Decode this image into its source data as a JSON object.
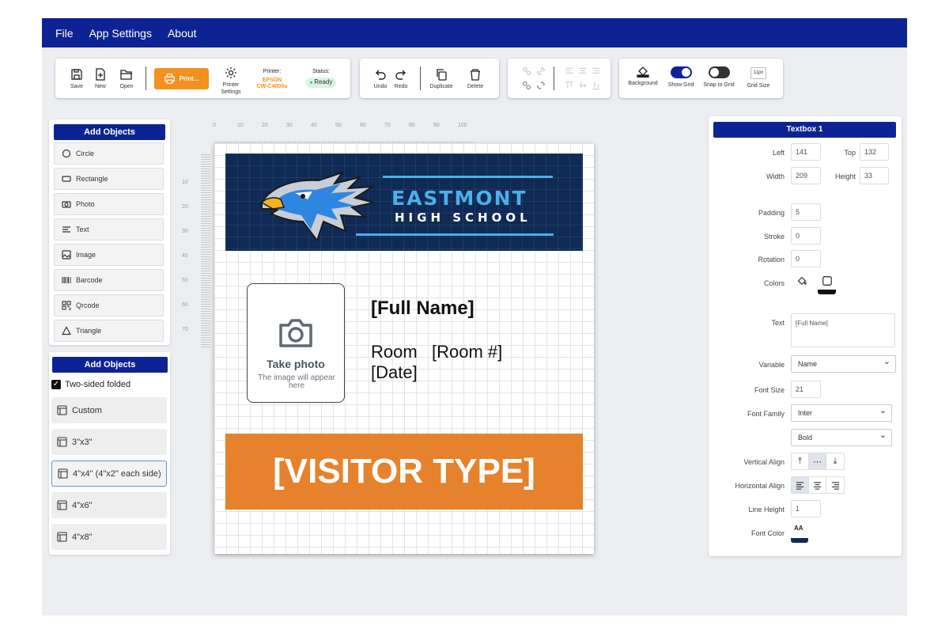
{
  "menu": [
    "File",
    "App Settings",
    "About"
  ],
  "toolbar": {
    "file": {
      "save": "Save",
      "new": "New",
      "open": "Open"
    },
    "print_label": "Print...",
    "printer_settings": "Printer\nSettings",
    "printer_label": "Printer:",
    "printer_name_1": "EPSON",
    "printer_name_2": "CW-C4000u",
    "status_label": "Status:",
    "status_value": "Ready",
    "edit": {
      "undo": "Undo",
      "redo": "Redo",
      "duplicate": "Duplicate",
      "delete": "Delete"
    },
    "view": {
      "background": "Background",
      "show_grid": "Show Grid",
      "snap_to_grid": "Snap to Grid",
      "grid_size": "Grid Size",
      "grid_size_value": "11px"
    },
    "show_grid_on": true,
    "snap_to_grid_on": false
  },
  "add_objects": {
    "title": "Add Objects",
    "items": [
      {
        "label": "Circle",
        "icon": "circle-icon"
      },
      {
        "label": "Rectangle",
        "icon": "rectangle-icon"
      },
      {
        "label": "Photo",
        "icon": "camera-icon"
      },
      {
        "label": "Text",
        "icon": "text-icon"
      },
      {
        "label": "Image",
        "icon": "image-icon"
      },
      {
        "label": "Barcode",
        "icon": "barcode-icon"
      },
      {
        "label": "Qrcode",
        "icon": "qrcode-icon"
      },
      {
        "label": "Triangle",
        "icon": "triangle-icon"
      }
    ]
  },
  "templates": {
    "title": "Add Objects",
    "two_sided_label": "Two-sided folded",
    "two_sided_checked": true,
    "items": [
      "Custom",
      "3\"x3\"",
      "4\"x4\" (4\"x2\" each side)",
      "4\"x6\"",
      "4\"x8\""
    ],
    "selected": "4\"x4\" (4\"x2\" each side)"
  },
  "rulers": {
    "horizontal": [
      "0",
      "10",
      "20",
      "30",
      "40",
      "50",
      "60",
      "70",
      "80",
      "90",
      "100"
    ],
    "vertical": [
      "10",
      "20",
      "30",
      "40",
      "50",
      "60",
      "70"
    ]
  },
  "badge": {
    "school_name": "EASTMONT",
    "school_sub": "HIGH SCHOOL",
    "photo_title": "Take photo",
    "photo_hint": "The image will appear here",
    "full_name": "[Full Name]",
    "room": "Room   [Room #]",
    "date": "[Date]",
    "visitor_type": "[VISITOR TYPE]",
    "colors": {
      "header_bg": "#0f2a55",
      "accent_blue": "#4ab0e8",
      "visitor_bg": "#e6822b"
    }
  },
  "properties": {
    "title": "Textbox 1",
    "left_label": "Left",
    "left": "141",
    "top_label": "Top",
    "top": "132",
    "width_label": "Width",
    "width": "209",
    "height_label": "Height",
    "height": "33",
    "padding_label": "Padding",
    "padding": "5",
    "stroke_label": "Stroke",
    "stroke": "0",
    "rotation_label": "Rotation",
    "rotation": "0",
    "colors_label": "Colors",
    "text_label": "Text",
    "text": "[Full Name]",
    "variable_label": "Variable",
    "variable": "Name",
    "font_size_label": "Font Size",
    "font_size": "21",
    "font_family_label": "Font Family",
    "font_family": "Inter",
    "font_weight": "Bold",
    "valign_label": "Vertical Align",
    "halign_label": "Horizontal Align",
    "line_height_label": "Line Height",
    "line_height": "1",
    "font_color_label": "Font Color",
    "font_color_glyph": "AA",
    "accent": "#0e2393"
  }
}
